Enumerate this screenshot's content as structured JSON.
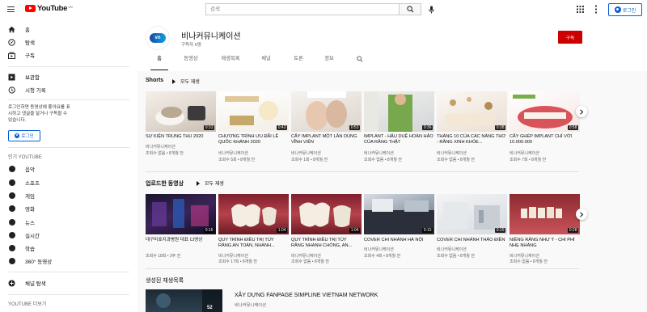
{
  "topbar": {
    "logo_text": "YouTube",
    "logo_country": "VN",
    "search_placeholder": "검색",
    "login_label": "로그인"
  },
  "sidebar": {
    "items": [
      {
        "label": "홈",
        "icon": "home-icon"
      },
      {
        "label": "탐색",
        "icon": "compass-icon"
      },
      {
        "label": "구독",
        "icon": "subscriptions-icon"
      },
      {
        "label": "보관함",
        "icon": "library-icon"
      },
      {
        "label": "시청 기록",
        "icon": "history-icon"
      }
    ],
    "signin_note": "로그인하면 동영상에 좋아요를 표시하고 댓글을 달거나 구독할 수 있습니다.",
    "signin_button": "로그인",
    "best_heading": "인기 YOUTUBE",
    "categories": [
      {
        "label": "음악",
        "icon": "music-icon"
      },
      {
        "label": "스포츠",
        "icon": "sports-icon"
      },
      {
        "label": "게임",
        "icon": "gaming-icon"
      },
      {
        "label": "영화",
        "icon": "movies-icon"
      },
      {
        "label": "뉴스",
        "icon": "news-icon"
      },
      {
        "label": "실시간",
        "icon": "live-icon"
      },
      {
        "label": "학습",
        "icon": "learning-icon"
      },
      {
        "label": "360° 동영상",
        "icon": "360-icon"
      }
    ],
    "browse_channels": "채널 탐색",
    "more_heading": "YOUTUBE 더보기"
  },
  "channel": {
    "avatar_text": "vn",
    "name": "비나커뮤니케이션",
    "subscribers": "구독자 5명",
    "subscribe_label": "구독",
    "tabs": [
      "홈",
      "동영상",
      "재생목록",
      "채널",
      "토론",
      "정보"
    ]
  },
  "shorts": {
    "title": "Shorts",
    "play_all": "모두 재생",
    "videos": [
      {
        "title": "SỰ KIỆN TRUNG THU 2020",
        "channel": "비나커뮤니케이션",
        "meta": "조회수 없음 • 8개월 전",
        "duration": "0:33"
      },
      {
        "title": "CHƯƠNG TRÌNH ƯU ĐÃI LỄ QUỐC KHÁNH 2020",
        "channel": "비나커뮤니케이션",
        "meta": "조회수 5회 • 8개월 전",
        "duration": "0:43"
      },
      {
        "title": "CẤY IMPLANT MỘT LẦN DÙNG VĨNH VIỄN",
        "channel": "비나커뮤니케이션",
        "meta": "조회수 1회 • 8개월 전",
        "duration": "0:53"
      },
      {
        "title": "IMPLANT - HẬU DUỆ HOÀN HẢO CỦA RĂNG THẬT",
        "channel": "비나커뮤니케이션",
        "meta": "조회수 없음 • 8개월 전",
        "duration": "0:36"
      },
      {
        "title": "THÁNG 10 CỦA CÁC NÀNG THƠ - RĂNG XINH KHỎE...",
        "channel": "비나커뮤니케이션",
        "meta": "조회수 없음 • 8개월 전",
        "duration": "0:38"
      },
      {
        "title": "CẤY GHÉP IMPLANT CHỈ VỚI 10.000.000",
        "channel": "비나커뮤니케이션",
        "meta": "조회수 7회 • 8개월 전",
        "duration": "0:58"
      }
    ]
  },
  "uploads": {
    "title": "업로드한 동영상",
    "play_all": "모두 재생",
    "videos": [
      {
        "title": "대구미호지과병원 대표 CI영상",
        "channel": "",
        "meta": "조회수 18회 • 3주 전",
        "duration": "0:16"
      },
      {
        "title": "QUY TRÌNH ĐIỀU TRỊ TỦY RĂNG AN TOÀN, NHANH...",
        "channel": "비나커뮤니케이션",
        "meta": "조회수 17회 • 8개월 전",
        "duration": "1:04"
      },
      {
        "title": "QUY TRÌNH ĐIỀU TRỊ TỦY RĂNG NHANH CHÓNG, AN...",
        "channel": "비나커뮤니케이션",
        "meta": "조회수 없음 • 8개월 전",
        "duration": "1:04"
      },
      {
        "title": "COVER CHI NHÁNH HÀ NỘI",
        "channel": "비나커뮤니케이션",
        "meta": "조회수 4회 • 8개월 전",
        "duration": "0:15"
      },
      {
        "title": "COVER CHI NHÁNH THẢO ĐIỀN",
        "channel": "비나커뮤니케이션",
        "meta": "조회수 없음 • 8개월 전",
        "duration": "0:15"
      },
      {
        "title": "NIỀNG RĂNG NHƯ Ý - CHI PHÍ NHẸ NHÀNG",
        "channel": "비나커뮤니케이션",
        "meta": "조회수 없음 • 8개월 전",
        "duration": "0:28"
      }
    ]
  },
  "playlists": {
    "title": "생성된 재생목록",
    "items": [
      {
        "title": "XÂY DỰNG FANPAGE SIMPLINE VIETNAM NETWORK",
        "channel": "비나커뮤니케이션",
        "count": "52"
      }
    ]
  },
  "colors": {
    "brand_red": "#ff0000",
    "subscribe_red": "#cc0000",
    "link_blue": "#065fd4"
  }
}
